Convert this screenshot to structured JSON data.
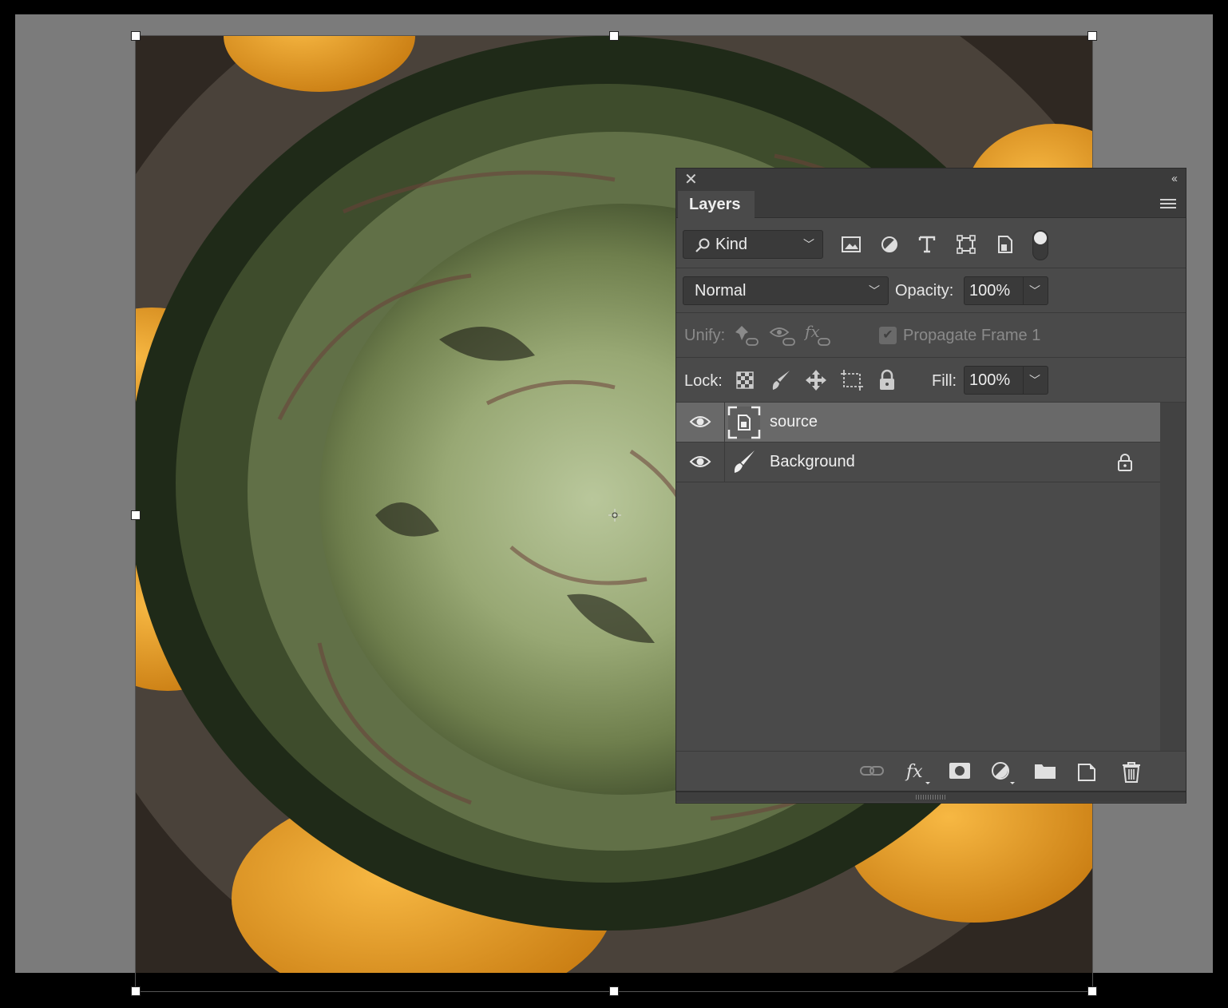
{
  "panel": {
    "close_icon": "close-icon",
    "collapse_icon": "collapse-icon",
    "tab_label": "Layers",
    "menu_icon": "panel-menu-icon"
  },
  "filter": {
    "kind_label": "Kind",
    "icons": [
      "pixel-filter-icon",
      "adjustment-filter-icon",
      "type-filter-icon",
      "shape-filter-icon",
      "smart-object-filter-icon",
      "filter-toggle-icon"
    ]
  },
  "blend": {
    "mode": "Normal",
    "opacity_label": "Opacity:",
    "opacity_value": "100%"
  },
  "unify": {
    "label": "Unify:",
    "propagate_label": "Propagate Frame 1",
    "propagate_checked": true
  },
  "lock": {
    "label": "Lock:",
    "fill_label": "Fill:",
    "fill_value": "100%"
  },
  "layers": [
    {
      "name": "source",
      "visible": true,
      "selected": true,
      "type": "smart-object",
      "locked": false
    },
    {
      "name": "Background",
      "visible": true,
      "selected": false,
      "type": "pixel",
      "locked": true
    }
  ],
  "colors": {
    "panel_bg": "#4a4a4a",
    "selected_row": "#696969",
    "canvas_bg": "#7b7b7b"
  }
}
